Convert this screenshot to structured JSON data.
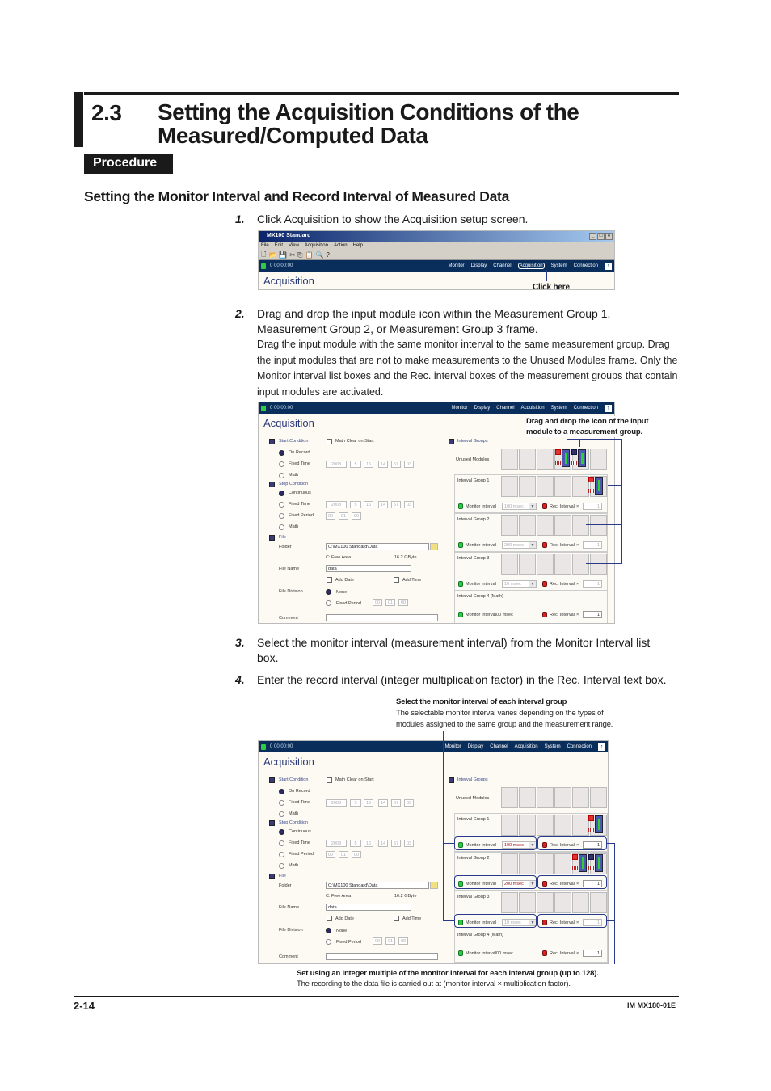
{
  "section": {
    "number": "2.3",
    "title_line1": "Setting the Acquisition Conditions of the",
    "title_line2": "Measured/Computed Data"
  },
  "procedure_label": "Procedure",
  "subsection_title": "Setting the Monitor Interval and Record Interval of Measured Data",
  "steps": [
    {
      "num": "1.",
      "text": "Click Acquisition to show the Acquisition setup screen."
    },
    {
      "num": "2.",
      "text_line1": "Drag and drop the input module icon within the Measurement Group 1,",
      "text_line2": "Measurement Group 2, or Measurement Group 3 frame.",
      "detail": "Drag the input module with the same monitor interval to the same measurement group. Drag the input modules that are not to make measurements to the Unused Modules frame. Only the Monitor interval list boxes and the Rec. interval boxes of the measurement groups that contain input modules are activated."
    },
    {
      "num": "3.",
      "text": "Select the monitor interval (measurement interval) from the Monitor Interval list box."
    },
    {
      "num": "4.",
      "text": "Enter the record interval (integer multiplication factor) in the Rec. Interval text box."
    }
  ],
  "app": {
    "window_title": "MX100 Standard",
    "window_buttons": [
      "_",
      "□",
      "×"
    ],
    "menu": [
      "File",
      "Edit",
      "View",
      "Acquisition",
      "Action",
      "Help"
    ],
    "toolbar_icons": [
      "new-icon",
      "open-icon",
      "save-icon",
      "cut-icon",
      "copy-icon",
      "paste-icon",
      "zoom-icon",
      "help-icon"
    ],
    "toolbar_glyphs": [
      "🗋",
      "📂",
      "💾",
      "✂",
      "⎘",
      "📋",
      "🔍",
      "?"
    ],
    "elapsed_time": "0 00:00:00",
    "nav": [
      "Monitor",
      "Display",
      "Channel",
      "Acquisition",
      "System",
      "Connection"
    ],
    "nav_up": "↑",
    "screen_title": "Acquisition",
    "click_here": "Click here"
  },
  "form": {
    "start_condition": "Start Condition",
    "math_clear": "Math Clear on Start",
    "on_record": "On Record",
    "fixed_time": "Fixed Time",
    "math": "Math",
    "stop_condition": "Stop Condition",
    "continuous": "Continuous",
    "fixed_period": "Fixed Period",
    "date": {
      "year": "2003",
      "month": "5",
      "day": "16",
      "hour": "14",
      "min": "57",
      "sec": "03"
    },
    "period": {
      "h": "00",
      "m": "01",
      "s": "00"
    },
    "file": "File",
    "folder_label": "Folder",
    "folder_value": "C:\\MX100 Standard\\Data",
    "free_area_label": "C: Free Area",
    "free_area_value": "16.2 GByte",
    "file_name_label": "File Name",
    "file_name_value": "data",
    "add_date": "Add Date",
    "add_time": "Add Time",
    "file_division": "File Division",
    "none": "None",
    "comment": "Comment",
    "interval_groups": "Interval Groups",
    "unused_modules": "Unused Modules",
    "monitor_interval": "Monitor Interval",
    "rec_interval": "Rec. Interval",
    "times": "×",
    "groups": [
      {
        "name": "Interval Group 1",
        "monitor": "100 msec",
        "rec": "1"
      },
      {
        "name": "Interval Group 2",
        "monitor": "200 msec",
        "rec": "1"
      },
      {
        "name": "Interval Group 3",
        "monitor": "10 msec",
        "rec": "1"
      },
      {
        "name": "Interval Group 4 (Math)",
        "monitor": "100 msec",
        "rec": "1"
      }
    ]
  },
  "callouts": {
    "drag_drop_line1": "Drag and drop the icon of the input",
    "drag_drop_line2": "module to a measurement group.",
    "select_title": "Select the monitor interval of each interval group",
    "select_line1": "The selectable monitor interval varies depending on the types of",
    "select_line2": "modules assigned to the same group and the measurement range.",
    "set_title": "Set using an integer multiple of the monitor interval for each interval group (up to 128).",
    "set_line": "The recording to the data file is carried out at (monitor interval × multiplication factor)."
  },
  "footer": {
    "page": "2-14",
    "doc_id": "IM MX180-01E"
  }
}
